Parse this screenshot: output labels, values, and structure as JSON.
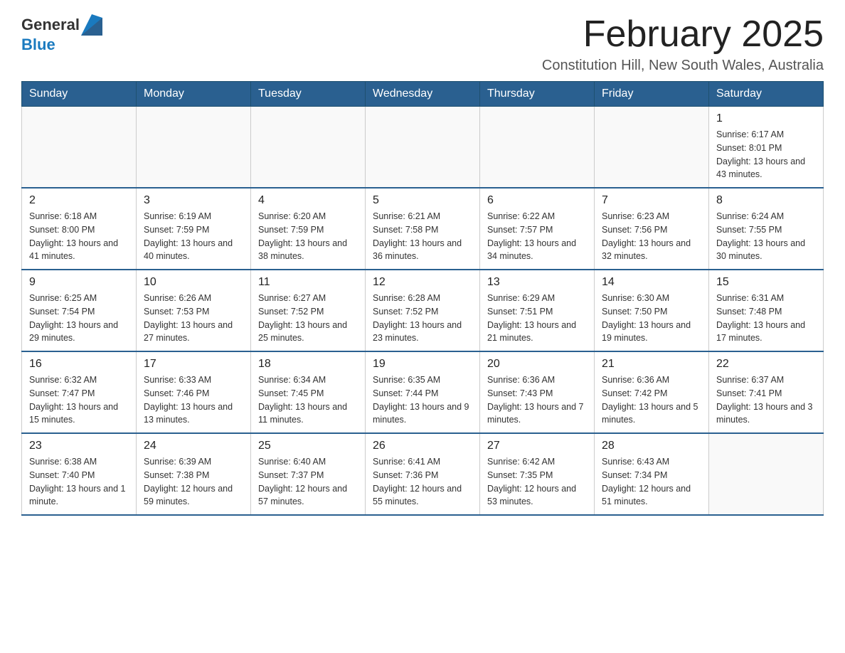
{
  "header": {
    "logo_general": "General",
    "logo_blue": "Blue",
    "month_title": "February 2025",
    "subtitle": "Constitution Hill, New South Wales, Australia"
  },
  "weekdays": [
    "Sunday",
    "Monday",
    "Tuesday",
    "Wednesday",
    "Thursday",
    "Friday",
    "Saturday"
  ],
  "weeks": [
    [
      {
        "day": "",
        "info": ""
      },
      {
        "day": "",
        "info": ""
      },
      {
        "day": "",
        "info": ""
      },
      {
        "day": "",
        "info": ""
      },
      {
        "day": "",
        "info": ""
      },
      {
        "day": "",
        "info": ""
      },
      {
        "day": "1",
        "info": "Sunrise: 6:17 AM\nSunset: 8:01 PM\nDaylight: 13 hours and 43 minutes."
      }
    ],
    [
      {
        "day": "2",
        "info": "Sunrise: 6:18 AM\nSunset: 8:00 PM\nDaylight: 13 hours and 41 minutes."
      },
      {
        "day": "3",
        "info": "Sunrise: 6:19 AM\nSunset: 7:59 PM\nDaylight: 13 hours and 40 minutes."
      },
      {
        "day": "4",
        "info": "Sunrise: 6:20 AM\nSunset: 7:59 PM\nDaylight: 13 hours and 38 minutes."
      },
      {
        "day": "5",
        "info": "Sunrise: 6:21 AM\nSunset: 7:58 PM\nDaylight: 13 hours and 36 minutes."
      },
      {
        "day": "6",
        "info": "Sunrise: 6:22 AM\nSunset: 7:57 PM\nDaylight: 13 hours and 34 minutes."
      },
      {
        "day": "7",
        "info": "Sunrise: 6:23 AM\nSunset: 7:56 PM\nDaylight: 13 hours and 32 minutes."
      },
      {
        "day": "8",
        "info": "Sunrise: 6:24 AM\nSunset: 7:55 PM\nDaylight: 13 hours and 30 minutes."
      }
    ],
    [
      {
        "day": "9",
        "info": "Sunrise: 6:25 AM\nSunset: 7:54 PM\nDaylight: 13 hours and 29 minutes."
      },
      {
        "day": "10",
        "info": "Sunrise: 6:26 AM\nSunset: 7:53 PM\nDaylight: 13 hours and 27 minutes."
      },
      {
        "day": "11",
        "info": "Sunrise: 6:27 AM\nSunset: 7:52 PM\nDaylight: 13 hours and 25 minutes."
      },
      {
        "day": "12",
        "info": "Sunrise: 6:28 AM\nSunset: 7:52 PM\nDaylight: 13 hours and 23 minutes."
      },
      {
        "day": "13",
        "info": "Sunrise: 6:29 AM\nSunset: 7:51 PM\nDaylight: 13 hours and 21 minutes."
      },
      {
        "day": "14",
        "info": "Sunrise: 6:30 AM\nSunset: 7:50 PM\nDaylight: 13 hours and 19 minutes."
      },
      {
        "day": "15",
        "info": "Sunrise: 6:31 AM\nSunset: 7:48 PM\nDaylight: 13 hours and 17 minutes."
      }
    ],
    [
      {
        "day": "16",
        "info": "Sunrise: 6:32 AM\nSunset: 7:47 PM\nDaylight: 13 hours and 15 minutes."
      },
      {
        "day": "17",
        "info": "Sunrise: 6:33 AM\nSunset: 7:46 PM\nDaylight: 13 hours and 13 minutes."
      },
      {
        "day": "18",
        "info": "Sunrise: 6:34 AM\nSunset: 7:45 PM\nDaylight: 13 hours and 11 minutes."
      },
      {
        "day": "19",
        "info": "Sunrise: 6:35 AM\nSunset: 7:44 PM\nDaylight: 13 hours and 9 minutes."
      },
      {
        "day": "20",
        "info": "Sunrise: 6:36 AM\nSunset: 7:43 PM\nDaylight: 13 hours and 7 minutes."
      },
      {
        "day": "21",
        "info": "Sunrise: 6:36 AM\nSunset: 7:42 PM\nDaylight: 13 hours and 5 minutes."
      },
      {
        "day": "22",
        "info": "Sunrise: 6:37 AM\nSunset: 7:41 PM\nDaylight: 13 hours and 3 minutes."
      }
    ],
    [
      {
        "day": "23",
        "info": "Sunrise: 6:38 AM\nSunset: 7:40 PM\nDaylight: 13 hours and 1 minute."
      },
      {
        "day": "24",
        "info": "Sunrise: 6:39 AM\nSunset: 7:38 PM\nDaylight: 12 hours and 59 minutes."
      },
      {
        "day": "25",
        "info": "Sunrise: 6:40 AM\nSunset: 7:37 PM\nDaylight: 12 hours and 57 minutes."
      },
      {
        "day": "26",
        "info": "Sunrise: 6:41 AM\nSunset: 7:36 PM\nDaylight: 12 hours and 55 minutes."
      },
      {
        "day": "27",
        "info": "Sunrise: 6:42 AM\nSunset: 7:35 PM\nDaylight: 12 hours and 53 minutes."
      },
      {
        "day": "28",
        "info": "Sunrise: 6:43 AM\nSunset: 7:34 PM\nDaylight: 12 hours and 51 minutes."
      },
      {
        "day": "",
        "info": ""
      }
    ]
  ]
}
